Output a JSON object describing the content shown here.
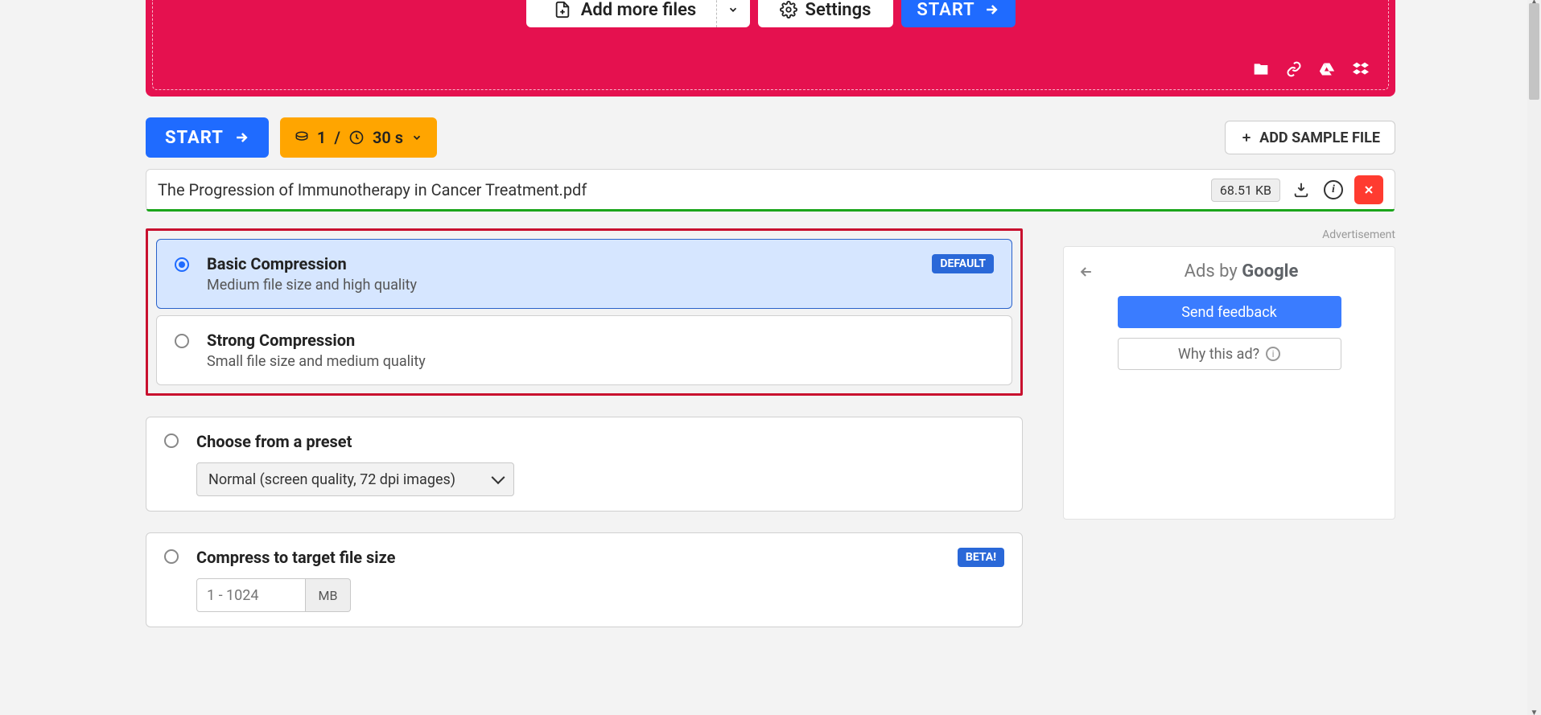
{
  "hero": {
    "add_more_files": "Add more files",
    "settings": "Settings",
    "start": "START"
  },
  "toolbar": {
    "start": "START",
    "chip_count": "1",
    "chip_sep": "/",
    "chip_time": "30 s",
    "add_sample": "ADD SAMPLE FILE"
  },
  "file": {
    "name": "The Progression of Immunotherapy in Cancer Treatment.pdf",
    "size": "68.51 KB"
  },
  "options": {
    "basic": {
      "title": "Basic Compression",
      "desc": "Medium file size and high quality",
      "badge": "DEFAULT"
    },
    "strong": {
      "title": "Strong Compression",
      "desc": "Small file size and medium quality"
    }
  },
  "preset": {
    "title": "Choose from a preset",
    "selected": "Normal (screen quality, 72 dpi images)"
  },
  "target": {
    "title": "Compress to target file size",
    "placeholder": "1 - 1024",
    "unit": "MB",
    "badge": "BETA!"
  },
  "ads": {
    "label": "Advertisement",
    "by": "Ads by",
    "google": "Google",
    "send_feedback": "Send feedback",
    "why": "Why this ad?"
  }
}
